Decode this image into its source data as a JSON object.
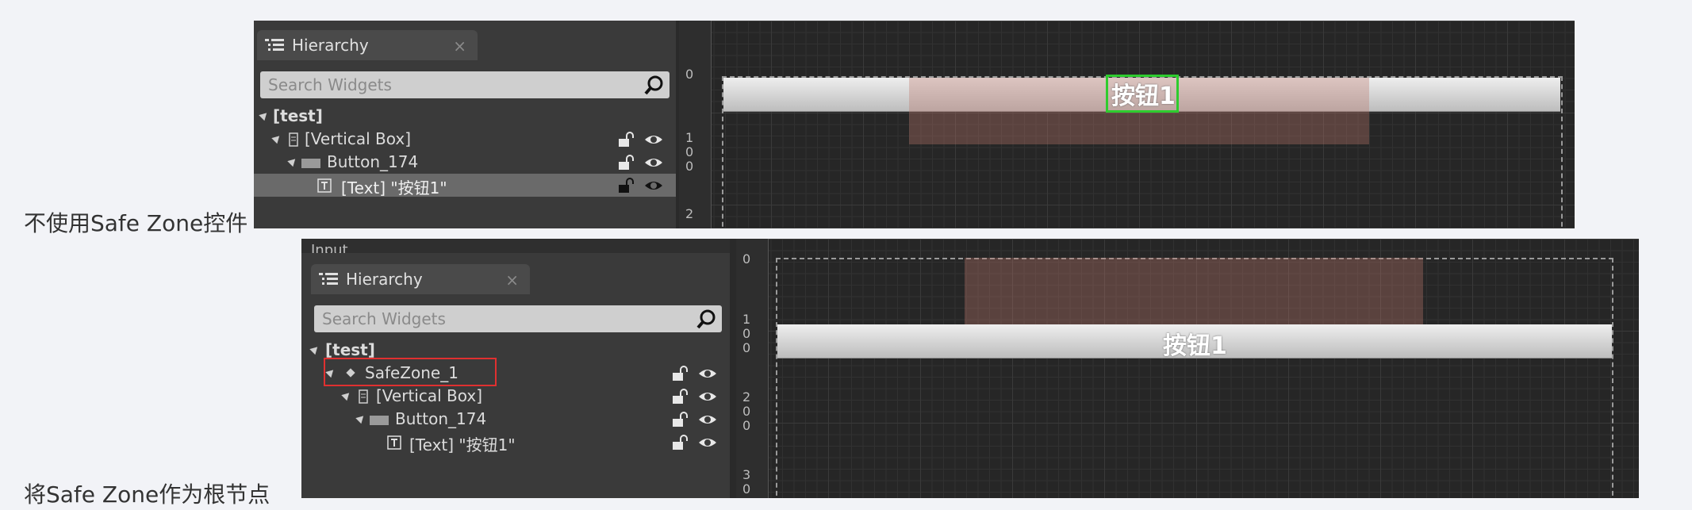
{
  "captions": {
    "top": "不使用Safe Zone控件",
    "bottom": "将Safe Zone作为根节点"
  },
  "top_shot": {
    "tab_label": "Hierarchy",
    "close_glyph": "×",
    "search_placeholder": "Search Widgets",
    "tree": [
      {
        "label": "[test]"
      },
      {
        "label": "[Vertical Box]"
      },
      {
        "label": "Button_174"
      },
      {
        "label": "[Text] \"按钮1\""
      }
    ],
    "ruler_labels": [
      "0",
      "1",
      "0",
      "0",
      "2"
    ],
    "button_text": "按钮1"
  },
  "bottom_shot": {
    "partial_label": "Input",
    "tab_label": "Hierarchy",
    "close_glyph": "×",
    "search_placeholder": "Search Widgets",
    "tree": [
      {
        "label": "[test]"
      },
      {
        "label": "SafeZone_1"
      },
      {
        "label": "[Vertical Box]"
      },
      {
        "label": "Button_174"
      },
      {
        "label": "[Text] \"按钮1\""
      }
    ],
    "ruler_labels": [
      "0",
      "1",
      "0",
      "0",
      "2",
      "0",
      "0",
      "3",
      "0"
    ],
    "button_text": "按钮1"
  },
  "colors": {
    "panel_bg": "#3a3a3a",
    "selection_green": "#2ecc2e",
    "highlight_red": "#e03030"
  }
}
